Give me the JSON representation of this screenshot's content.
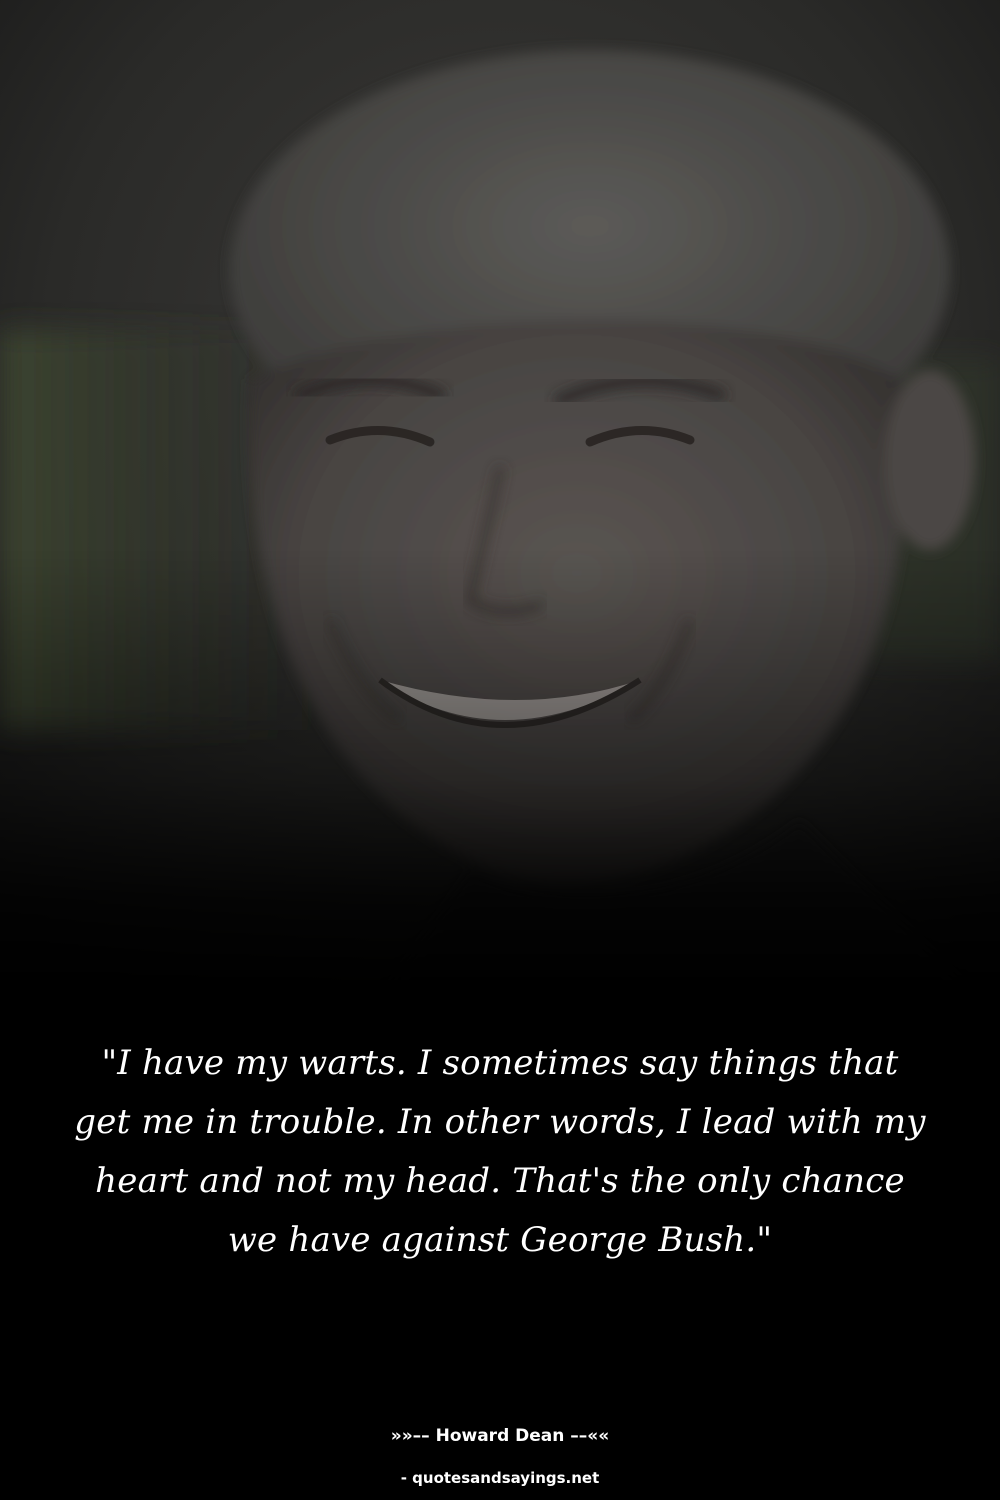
{
  "quote": {
    "text": "\"I have my warts. I sometimes say things that get me in trouble. In other words, I lead with my heart and not my head. That's the only chance we have against George Bush.\"",
    "author_line": "»»–– Howard Dean ––««"
  },
  "source": {
    "text": "- quotesandsayings.net"
  },
  "colors": {
    "background": "#000000",
    "text": "#ffffff"
  }
}
